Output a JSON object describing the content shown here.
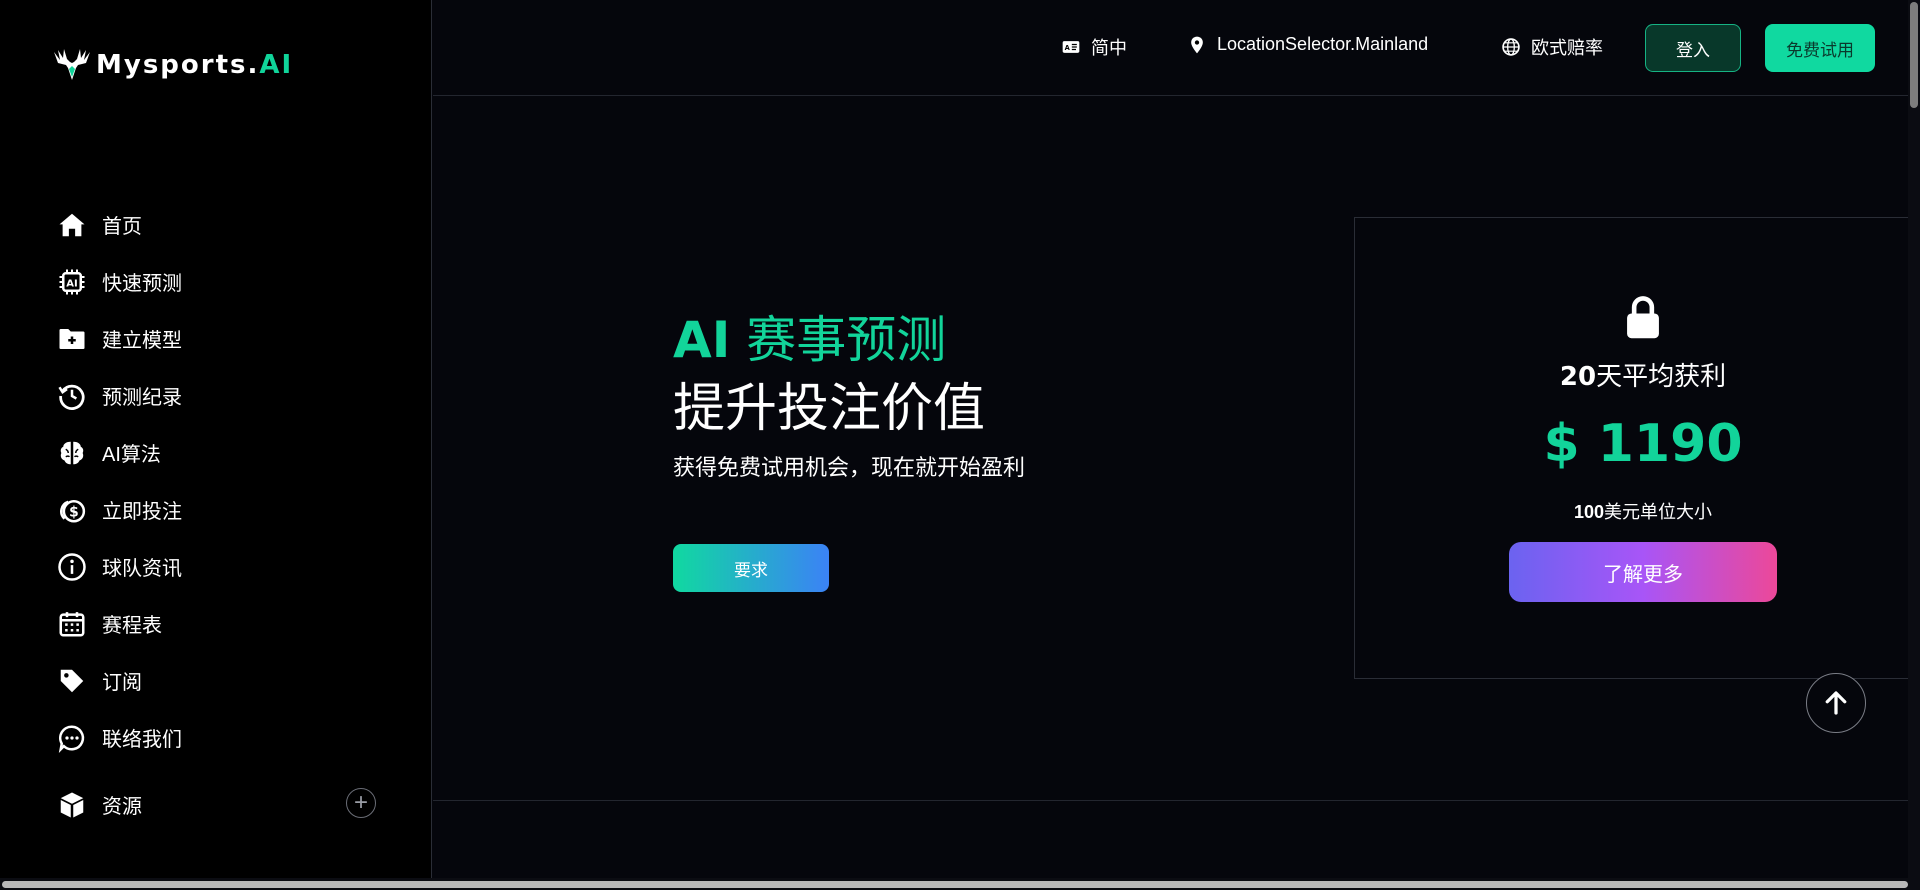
{
  "brand": {
    "name_main": "Mysports.",
    "name_accent": "AI",
    "accent_color": "#10d49a"
  },
  "sidebar": {
    "items": [
      {
        "label": "首页",
        "icon": "home-icon"
      },
      {
        "label": "快速预测",
        "icon": "ai-chip-icon"
      },
      {
        "label": "建立模型",
        "icon": "folder-plus-icon"
      },
      {
        "label": "预测纪录",
        "icon": "history-icon"
      },
      {
        "label": "AI算法",
        "icon": "brain-icon"
      },
      {
        "label": "立即投注",
        "icon": "coin-icon"
      },
      {
        "label": "球队资讯",
        "icon": "info-icon"
      },
      {
        "label": "赛程表",
        "icon": "calendar-icon"
      },
      {
        "label": "订阅",
        "icon": "tag-icon"
      },
      {
        "label": "联络我们",
        "icon": "chat-icon"
      }
    ],
    "resource": {
      "label": "资源",
      "icon": "box-icon",
      "expand_icon": "plus-circle-icon"
    }
  },
  "header": {
    "language": "简中",
    "location": "LocationSelector.Mainland",
    "odds_format": "欧式赔率",
    "login": "登入",
    "free_trial": "免费试用"
  },
  "hero": {
    "title_ai": "AI",
    "title_rest": " 赛事预测",
    "title_line2": "提升投注价值",
    "subtitle": "获得免费试用机会，现在就开始盈利",
    "cta": "要求"
  },
  "card": {
    "days_num": "20",
    "days_text": "天平均获利",
    "amount": "$ 1190",
    "unit_num": "100",
    "unit_text": "美元单位大小",
    "button": "了解更多"
  }
}
